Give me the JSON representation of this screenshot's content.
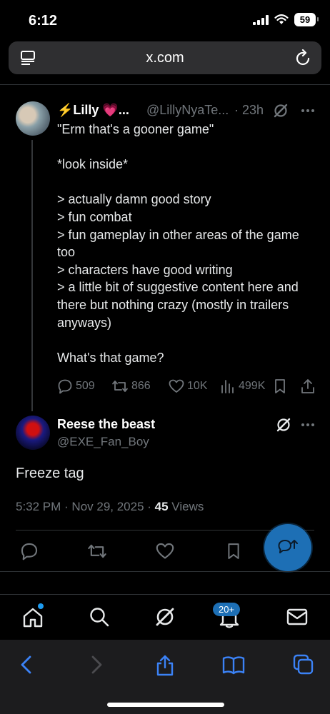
{
  "status_bar": {
    "time": "6:12",
    "battery": "59"
  },
  "browser": {
    "url": "x.com"
  },
  "post": {
    "author_name": "⚡Lilly 💗...",
    "handle": "@LillyNyaTe...",
    "time": "· 23h",
    "lines": [
      "\"Erm that's a gooner game\"",
      "",
      "*look inside*",
      "",
      "> actually damn good story",
      "> fun combat",
      "> fun gameplay in other areas of the game",
      "too",
      "> characters have good writing",
      "> a little bit of suggestive content here and",
      "there but nothing crazy (mostly in trailers",
      "anyways)",
      "",
      "What's that game?"
    ],
    "stats": {
      "replies": "509",
      "reposts": "866",
      "likes": "10K",
      "views": "499K"
    }
  },
  "reply": {
    "author_name": "Reese the beast",
    "handle": "@EXE_Fan_Boy",
    "text": "Freeze tag",
    "timestamp": "5:32 PM · Nov 29, 2025 · ",
    "views_count": "45",
    "views_label": " Views"
  },
  "tabbar": {
    "notifications_badge": "20+"
  },
  "colors": {
    "accent": "#1d9bf0",
    "fab": "#1d6fb5",
    "muted": "#71767b"
  }
}
